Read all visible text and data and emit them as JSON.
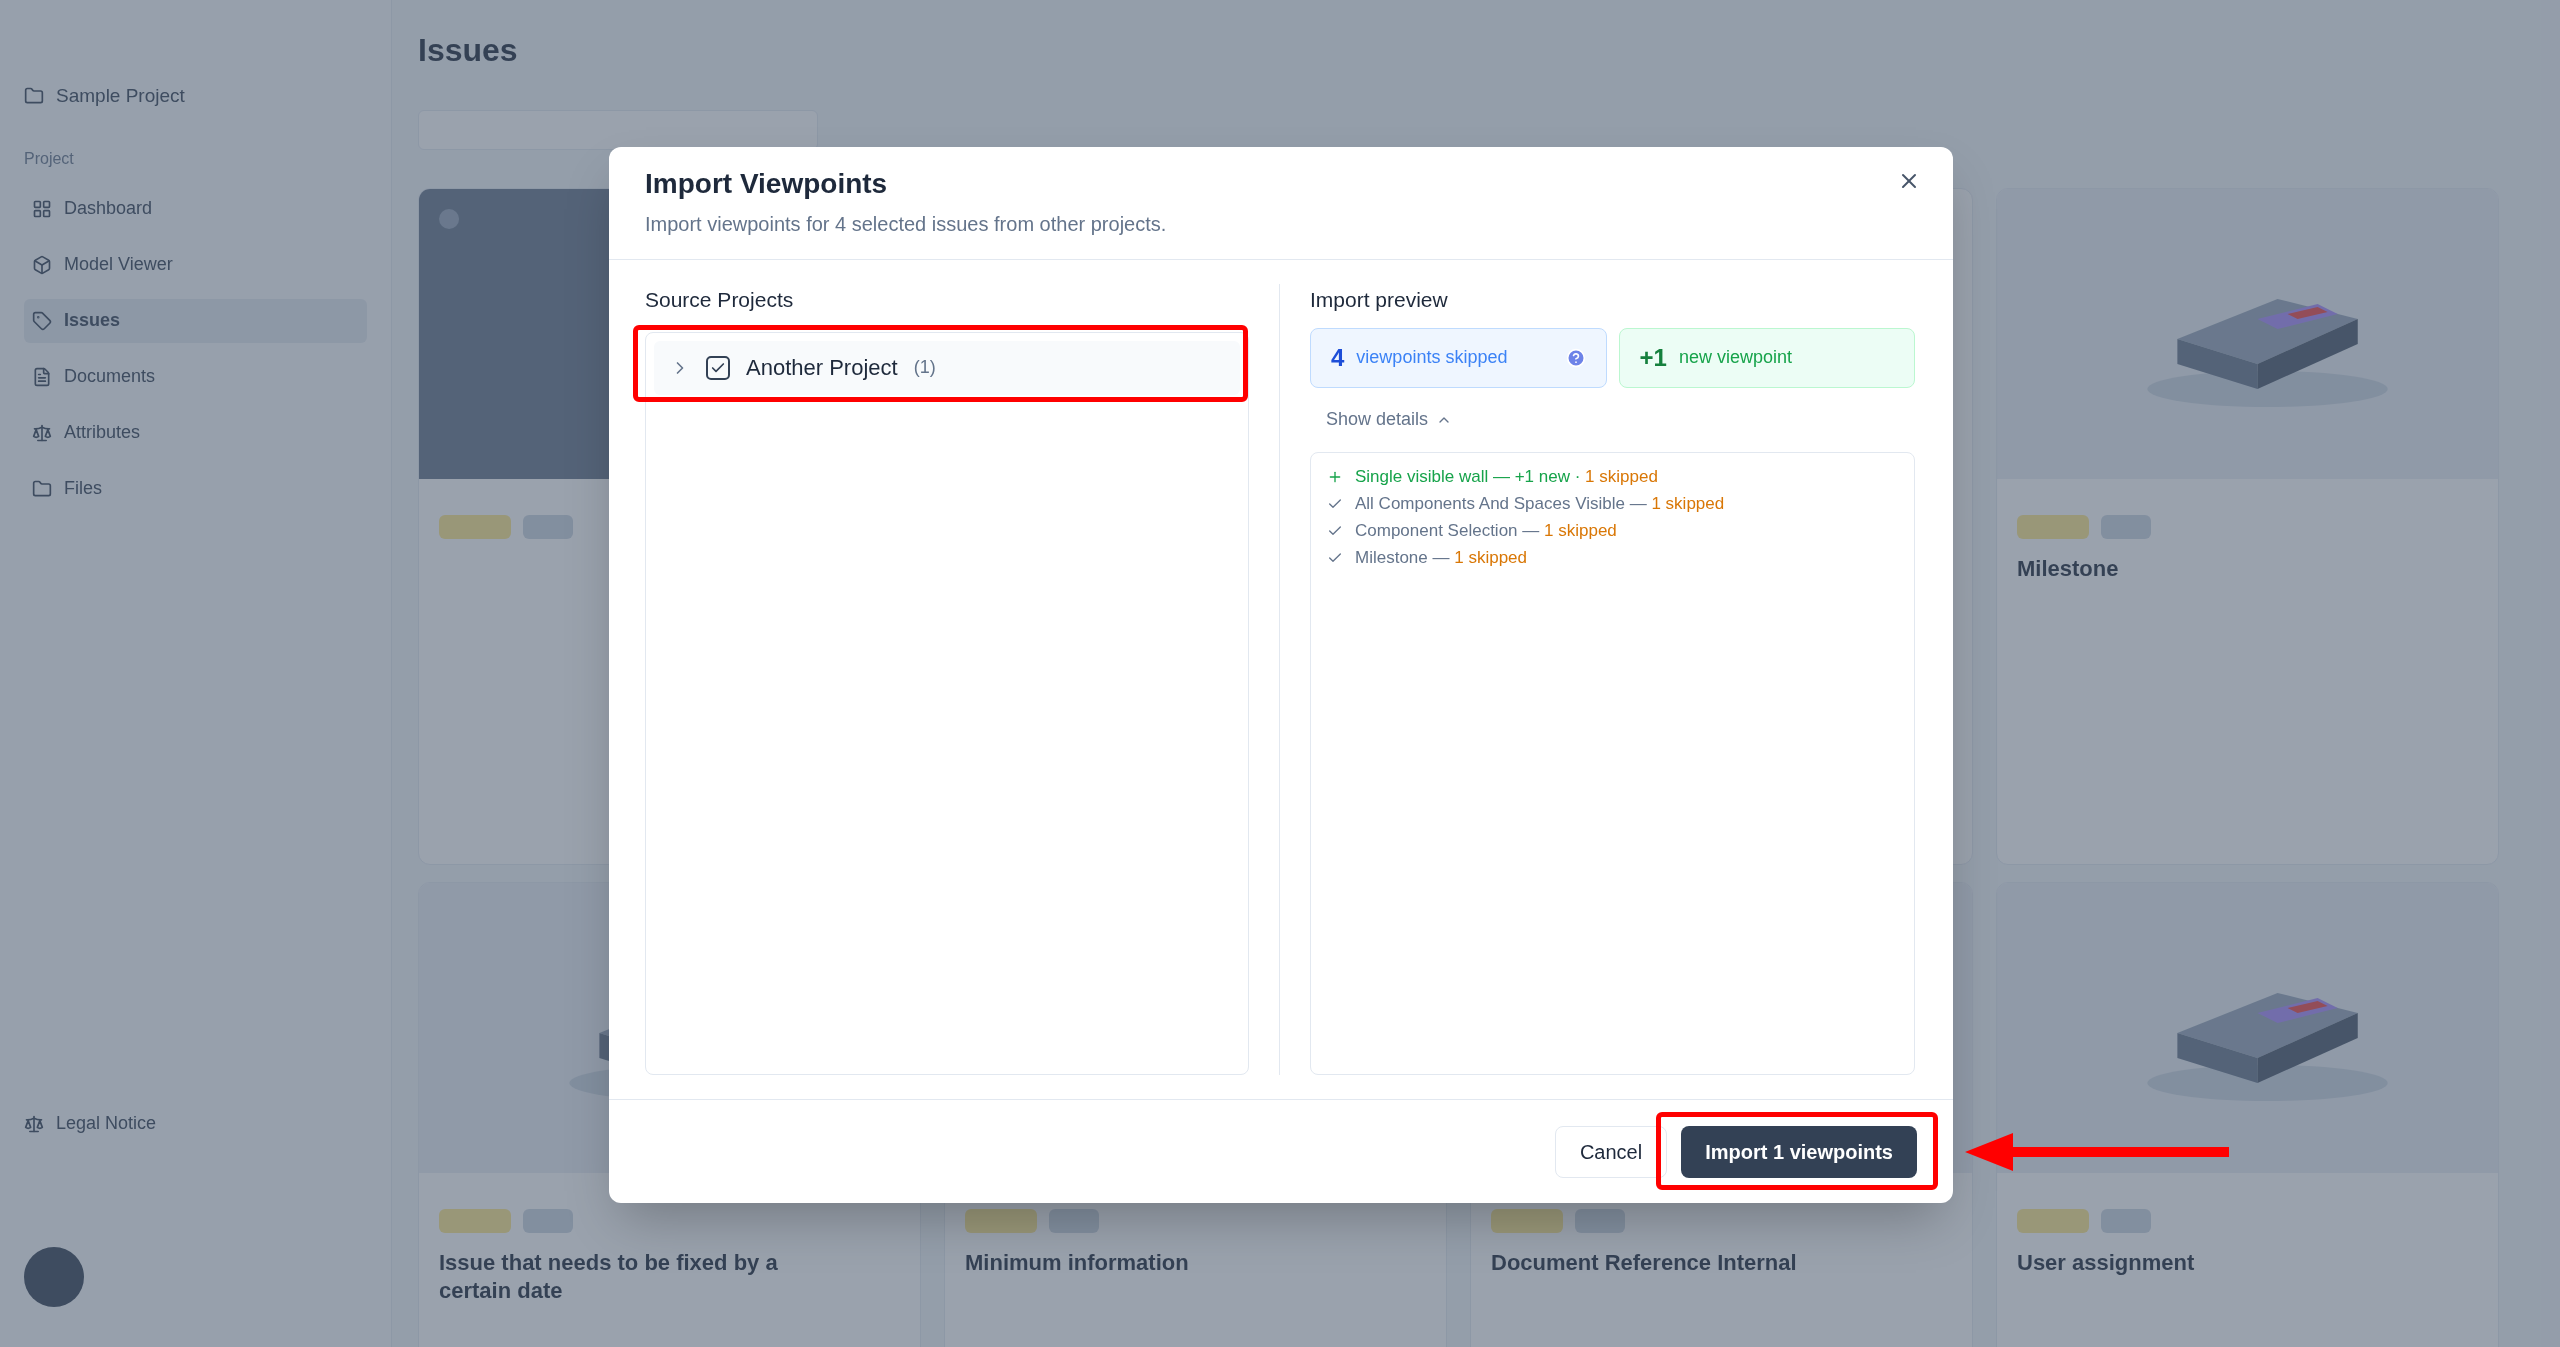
{
  "sidebar": {
    "project": "Sample Project",
    "section": "Project",
    "items": [
      {
        "label": "Dashboard",
        "selected": false
      },
      {
        "label": "Model Viewer",
        "selected": false
      },
      {
        "label": "Issues",
        "selected": true
      },
      {
        "label": "Documents",
        "selected": false
      },
      {
        "label": "Attributes",
        "selected": false
      },
      {
        "label": "Files",
        "selected": false
      }
    ],
    "footer_link": "Legal Notice"
  },
  "page": {
    "title": "Issues"
  },
  "cards": [
    {
      "kind": "blank"
    },
    {
      "kind": "covered"
    },
    {
      "kind": "edge"
    },
    {
      "kind": "model",
      "title": "Milestone"
    },
    {
      "kind": "model",
      "title": "Issue that needs to be fixed by a certain date"
    },
    {
      "kind": "text",
      "title": "Minimum information"
    },
    {
      "kind": "model",
      "title": "Document Reference Internal"
    },
    {
      "kind": "model",
      "title": "User assignment"
    }
  ],
  "dialog": {
    "title": "Import Viewpoints",
    "subtitle": "Import viewpoints for 4 selected issues from other projects.",
    "source_label": "Source Projects",
    "projects": [
      {
        "name": "Another Project",
        "count": "(1)",
        "checked": true,
        "expanded": false
      }
    ],
    "preview_label": "Import preview",
    "skipped": {
      "count": "4",
      "label": "viewpoints skipped"
    },
    "added": {
      "count": "+1",
      "label": "new viewpoint"
    },
    "details_toggle": {
      "label": "Show details",
      "expanded": true
    },
    "details": [
      {
        "kind": "new",
        "name": "Single visible wall —",
        "new": "+1 new ·",
        "skipped": "1 skipped"
      },
      {
        "kind": "existing",
        "name": "All Components And Spaces Visible —",
        "skipped": "1 skipped"
      },
      {
        "kind": "existing",
        "name": "Component Selection —",
        "skipped": "1 skipped"
      },
      {
        "kind": "existing",
        "name": "Milestone —",
        "skipped": "1 skipped"
      }
    ],
    "cancel": "Cancel",
    "confirm": "Import 1 viewpoints"
  }
}
